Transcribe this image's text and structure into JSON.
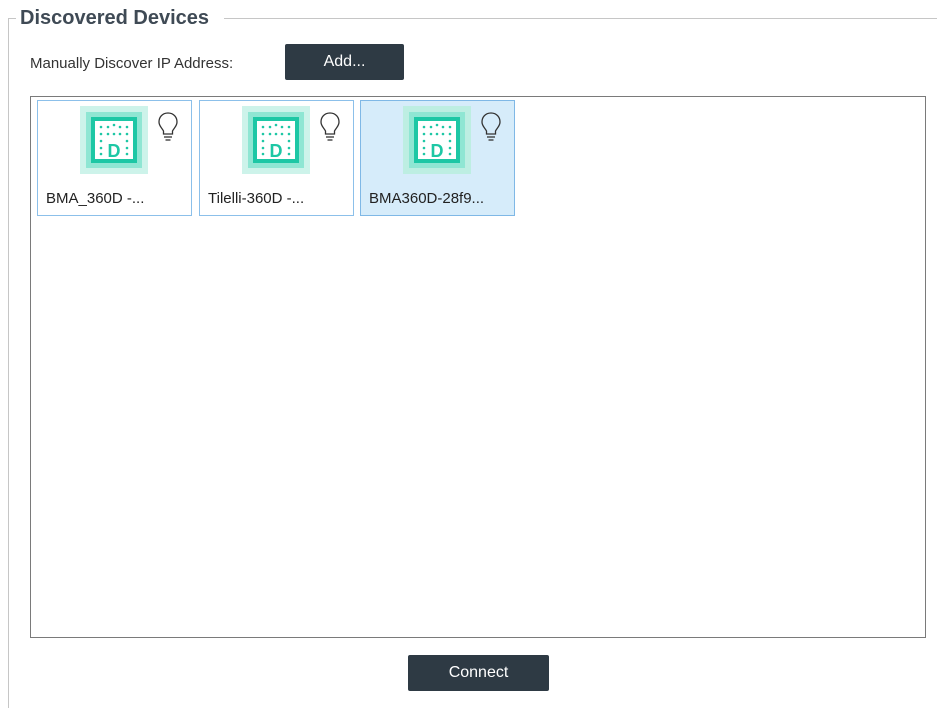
{
  "group": {
    "title": "Discovered Devices"
  },
  "manual_discover": {
    "label": "Manually Discover IP Address:",
    "add_button_label": "Add..."
  },
  "devices": [
    {
      "label": "BMA_360D -...",
      "selected": false
    },
    {
      "label": "Tilelli-360D -...",
      "selected": false
    },
    {
      "label": "BMA360D-28f9...",
      "selected": true
    }
  ],
  "actions": {
    "connect_label": "Connect"
  },
  "colors": {
    "button_bg": "#2e3a44",
    "device_icon_teal": "#1dc7a5",
    "selection_bg": "#d6ecfa",
    "tile_border": "#8cc0ea"
  },
  "icons": {
    "device": "device-tile-icon",
    "identify": "lightbulb-icon"
  }
}
